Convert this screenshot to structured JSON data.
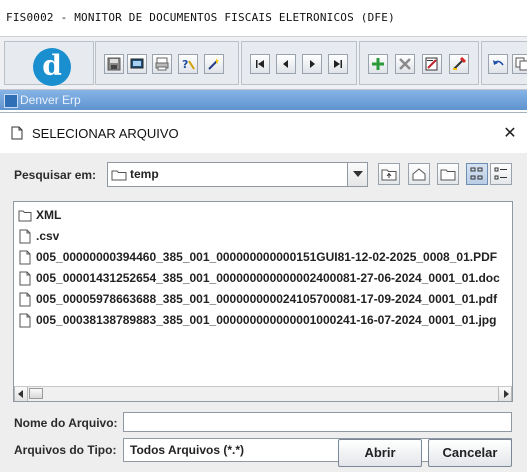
{
  "window": {
    "title": "FIS0002 - MONITOR DE DOCUMENTOS FISCAIS ELETRONICOS (DFE)"
  },
  "logo": {
    "letter": "d"
  },
  "toolbar": {
    "icons": [
      "save-icon",
      "screen-icon",
      "print-icon",
      "help-query-icon",
      "magic-icon",
      "first-icon",
      "prev-icon",
      "next-icon",
      "last-icon",
      "add-icon",
      "delete-icon",
      "edit-record-icon",
      "cancel-edit-icon",
      "undo-icon"
    ]
  },
  "erp": {
    "label": "Denver Erp"
  },
  "dialog": {
    "title": "SELECIONAR ARQUIVO",
    "close_glyph": "✕",
    "look_in_label": "Pesquisar em:",
    "look_in_value": "temp",
    "files": [
      {
        "name": "XML",
        "type": "folder"
      },
      {
        "name": ".csv",
        "type": "file"
      },
      {
        "name": "005_00000000394460_385_001_000000000000151GUI81-12-02-2025_0008_01.PDF",
        "type": "file"
      },
      {
        "name": "005_00001431252654_385_001_000000000000002400081-27-06-2024_0001_01.doc",
        "type": "file"
      },
      {
        "name": "005_00005978663688_385_001_000000000024105700081-17-09-2024_0001_01.pdf",
        "type": "file"
      },
      {
        "name": "005_00038138789883_385_001_000000000000001000241-16-07-2024_0001_01.jpg",
        "type": "file"
      }
    ],
    "filename_label": "Nome do Arquivo:",
    "filename_value": "",
    "filetype_label": "Arquivos do Tipo:",
    "filetype_value": "Todos Arquivos (*.*)",
    "open_label": "Abrir",
    "cancel_label": "Cancelar"
  },
  "colors": {
    "erp_bar": "#6f9fd8",
    "logo": "#1a8fd0",
    "accent": "#2f6fb5"
  }
}
